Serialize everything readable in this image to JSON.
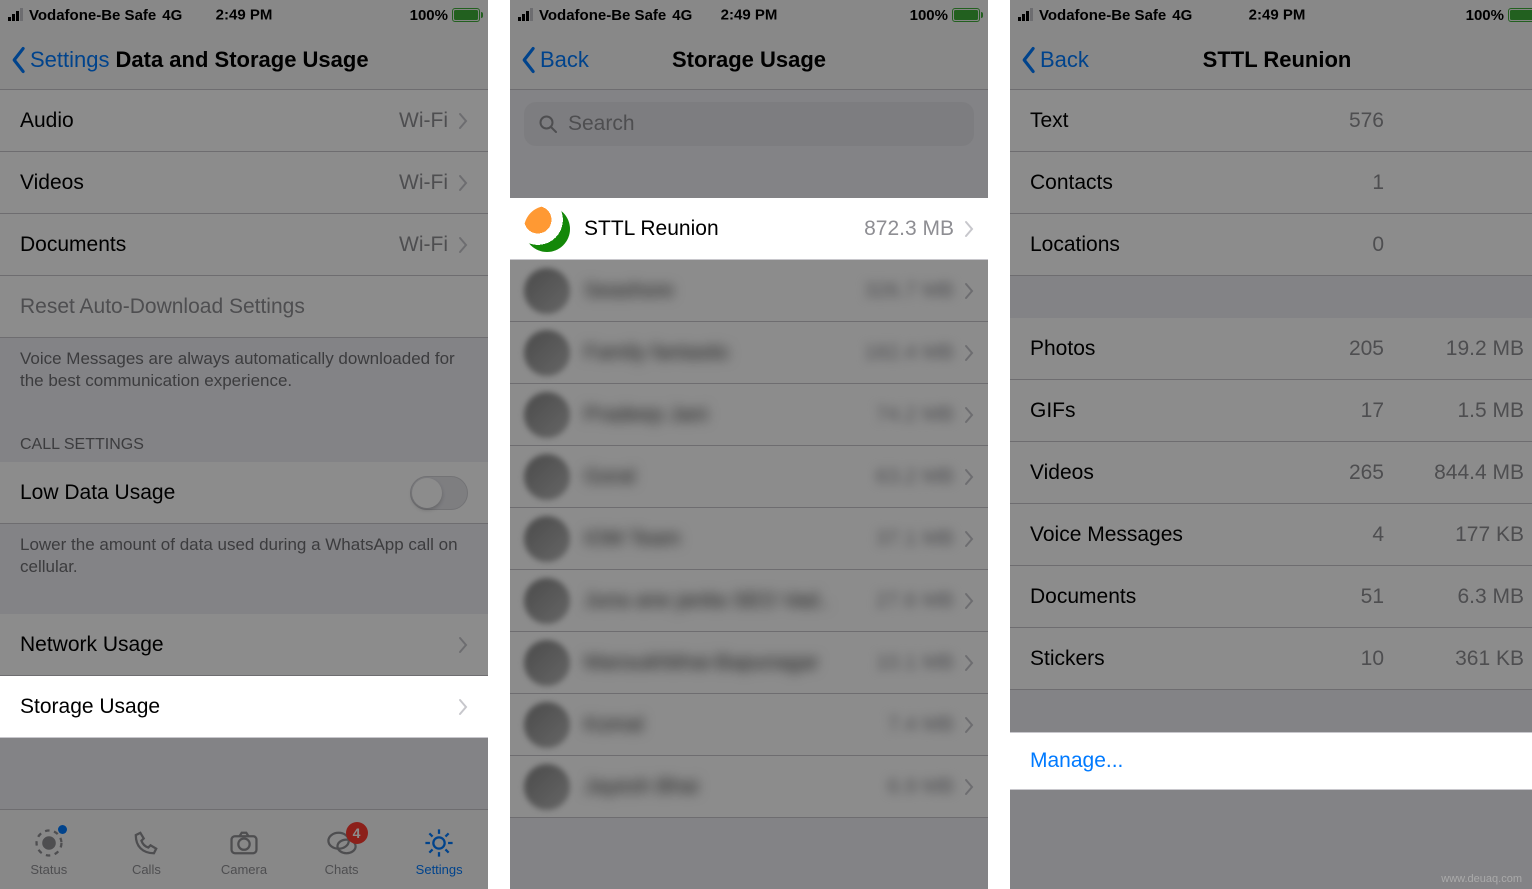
{
  "statusbar": {
    "carrier": "Vodafone-Be Safe",
    "network": "4G",
    "time": "2:49 PM",
    "battery": "100%"
  },
  "screen1": {
    "back_label": "Settings",
    "title": "Data and Storage Usage",
    "rows": {
      "audio": {
        "label": "Audio",
        "value": "Wi-Fi"
      },
      "videos": {
        "label": "Videos",
        "value": "Wi-Fi"
      },
      "documents": {
        "label": "Documents",
        "value": "Wi-Fi"
      },
      "reset": {
        "label": "Reset Auto-Download Settings"
      }
    },
    "footer_voice": "Voice Messages are always automatically downloaded for the best communication experience.",
    "call_section": "CALL SETTINGS",
    "low_data": {
      "label": "Low Data Usage"
    },
    "footer_low": "Lower the amount of data used during a WhatsApp call on cellular.",
    "network_usage": {
      "label": "Network Usage"
    },
    "storage_usage": {
      "label": "Storage Usage"
    },
    "tabs": {
      "status": "Status",
      "calls": "Calls",
      "camera": "Camera",
      "chats": "Chats",
      "chats_badge": "4",
      "settings": "Settings"
    }
  },
  "screen2": {
    "back_label": "Back",
    "title": "Storage Usage",
    "search_placeholder": "Search",
    "chats": [
      {
        "name": "STTL Reunion",
        "size": "872.3 MB"
      },
      {
        "name": "Seashore",
        "size": "326.7 MB"
      },
      {
        "name": "Family fantastic",
        "size": "182.4 MB"
      },
      {
        "name": "Pradeep Jani",
        "size": "74.2 MB"
      },
      {
        "name": "Goral",
        "size": "63.2 MB"
      },
      {
        "name": "IOM Team",
        "size": "37.1 MB"
      },
      {
        "name": "Juna ane janita SEO Vad..",
        "size": "27.6 MB"
      },
      {
        "name": "Mansukhbhai-Bapunagar",
        "size": "10.1 MB"
      },
      {
        "name": "Komal",
        "size": "7.4 MB"
      },
      {
        "name": "Jayesh Bhai",
        "size": "6.9 MB"
      }
    ]
  },
  "screen3": {
    "back_label": "Back",
    "title": "STTL Reunion",
    "section1": [
      {
        "label": "Text",
        "count": "576"
      },
      {
        "label": "Contacts",
        "count": "1"
      },
      {
        "label": "Locations",
        "count": "0"
      }
    ],
    "section2": [
      {
        "label": "Photos",
        "count": "205",
        "size": "19.2 MB"
      },
      {
        "label": "GIFs",
        "count": "17",
        "size": "1.5 MB"
      },
      {
        "label": "Videos",
        "count": "265",
        "size": "844.4 MB"
      },
      {
        "label": "Voice Messages",
        "count": "4",
        "size": "177 KB"
      },
      {
        "label": "Documents",
        "count": "51",
        "size": "6.3 MB"
      },
      {
        "label": "Stickers",
        "count": "10",
        "size": "361 KB"
      }
    ],
    "manage": "Manage..."
  },
  "watermark": "www.deuaq.com"
}
